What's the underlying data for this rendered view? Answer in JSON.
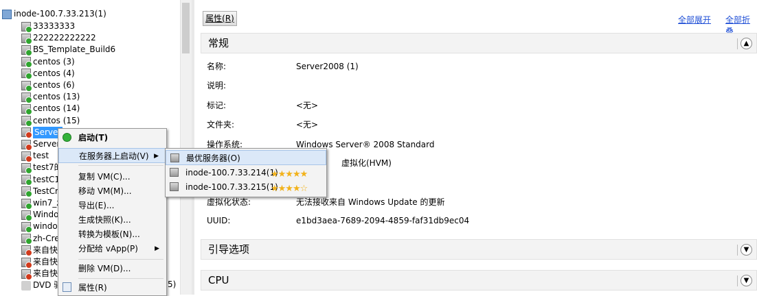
{
  "tree": {
    "root": "inode-100.7.33.213(1)",
    "items": [
      {
        "label": "33333333",
        "status": "green"
      },
      {
        "label": "222222222222",
        "status": "green"
      },
      {
        "label": "BS_Template_Build6",
        "status": "green"
      },
      {
        "label": "centos (3)",
        "status": "green"
      },
      {
        "label": "centos (4)",
        "status": "green"
      },
      {
        "label": "centos (6)",
        "status": "green"
      },
      {
        "label": "centos (13)",
        "status": "green"
      },
      {
        "label": "centos (14)",
        "status": "green"
      },
      {
        "label": "centos (15)",
        "status": "green"
      },
      {
        "label": "Server",
        "status": "red"
      },
      {
        "label": "Server",
        "status": "red"
      },
      {
        "label": "test",
        "status": "red"
      },
      {
        "label": "test7的",
        "status": "green"
      },
      {
        "label": "testC1",
        "status": "green"
      },
      {
        "label": "TestCr",
        "status": "green"
      },
      {
        "label": "win7_z",
        "status": "green"
      },
      {
        "label": "Windo",
        "status": "green"
      },
      {
        "label": "windo",
        "status": "green"
      },
      {
        "label": "zh-Cre",
        "status": "green"
      },
      {
        "label": "来自快",
        "status": "red"
      },
      {
        "label": "来自快",
        "status": "red"
      },
      {
        "label": "来自快",
        "status": "red"
      },
      {
        "label": "DVD 驱",
        "status": "none"
      }
    ],
    "partial_suffix": "5)"
  },
  "toolbar": {
    "properties_label": "属性(R)",
    "expand_all": "全部展开",
    "collapse_all": "全部折叠"
  },
  "general": {
    "title": "常规",
    "rows": [
      {
        "label": "名称:",
        "value": "Server2008 (1)"
      },
      {
        "label": "说明:",
        "value": ""
      },
      {
        "label": "标记:",
        "value": "<无>"
      },
      {
        "label": "文件夹:",
        "value": "<无>"
      },
      {
        "label": "操作系统:",
        "value": "Windows Server® 2008 Standard"
      },
      {
        "label": "",
        "value": "虚拟化(HVM)"
      },
      {
        "label": "",
        "value": ""
      },
      {
        "label": "虚拟化状态:",
        "value": "无法接收来自 Windows Update 的更新"
      },
      {
        "label": "UUID:",
        "value": "e1bd3aea-7689-2094-4859-faf31db9ec04"
      }
    ]
  },
  "sections": {
    "boot_title": "引导选项",
    "cpu_title": "CPU"
  },
  "context_menu": {
    "start": "启动(T)",
    "start_on_server": "在服务器上启动(V)",
    "copy_vm": "复制 VM(C)...",
    "move_vm": "移动 VM(M)...",
    "export": "导出(E)...",
    "snapshot": "生成快照(K)...",
    "convert_template": "转换为模板(N)...",
    "assign_vapp": "分配给 vApp(P)",
    "delete_vm": "删除 VM(D)...",
    "properties": "属性(R)"
  },
  "submenu": {
    "best_server": "最优服务器(O)",
    "servers": [
      {
        "label": "inode-100.7.33.214(1)",
        "rating": 5
      },
      {
        "label": "inode-100.7.33.215(1)",
        "rating": 4
      }
    ]
  }
}
